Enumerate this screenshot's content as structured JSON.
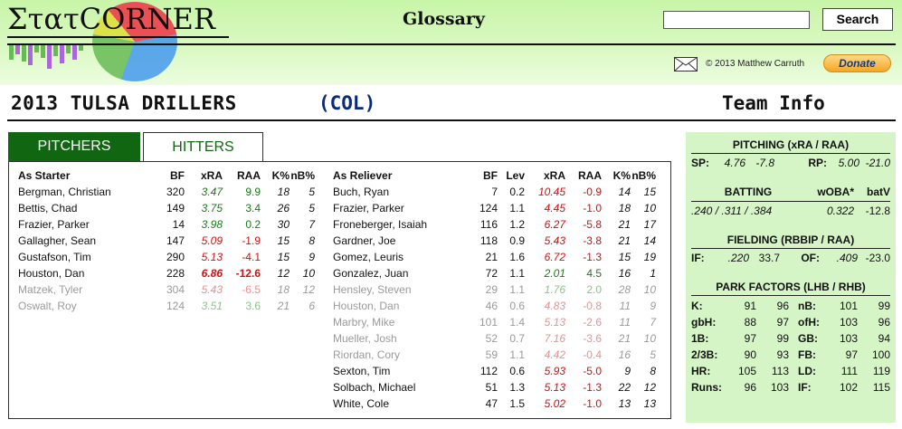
{
  "header": {
    "logo_text": "ΣτατCORNER",
    "glossary_label": "Glossary",
    "search_placeholder": "",
    "search_button": "Search",
    "copyright": "© 2013 Matthew Carruth",
    "donate_label": "Donate"
  },
  "team": {
    "title": "2013 TULSA DRILLERS",
    "abbr": "(COL)",
    "info_label": "Team Info"
  },
  "tabs": {
    "pitchers": "PITCHERS",
    "hitters": "HITTERS"
  },
  "starters": {
    "headers": [
      "As Starter",
      "BF",
      "xRA",
      "RAA",
      "K%",
      "nB%"
    ],
    "rows": [
      {
        "name": "Bergman, Christian",
        "bf": "320",
        "xra": "3.47",
        "raa": "9.9",
        "k": "18",
        "nb": "5",
        "xra_c": "green",
        "raa_c": "green",
        "dim": false
      },
      {
        "name": "Bettis, Chad",
        "bf": "149",
        "xra": "3.75",
        "raa": "3.4",
        "k": "26",
        "nb": "5",
        "xra_c": "green",
        "raa_c": "green",
        "dim": false
      },
      {
        "name": "Frazier, Parker",
        "bf": "14",
        "xra": "3.98",
        "raa": "0.2",
        "k": "30",
        "nb": "7",
        "xra_c": "green",
        "raa_c": "green",
        "dim": false
      },
      {
        "name": "Gallagher, Sean",
        "bf": "147",
        "xra": "5.09",
        "raa": "-1.9",
        "k": "15",
        "nb": "8",
        "xra_c": "red",
        "raa_c": "red",
        "dim": false
      },
      {
        "name": "Gustafson, Tim",
        "bf": "290",
        "xra": "5.13",
        "raa": "-4.1",
        "k": "15",
        "nb": "9",
        "xra_c": "red",
        "raa_c": "red",
        "dim": false
      },
      {
        "name": "Houston, Dan",
        "bf": "228",
        "xra": "6.86",
        "raa": "-12.6",
        "k": "12",
        "nb": "10",
        "xra_c": "red bold",
        "raa_c": "red bold",
        "dim": false
      },
      {
        "name": "Matzek, Tyler",
        "bf": "304",
        "xra": "5.43",
        "raa": "-6.5",
        "k": "18",
        "nb": "12",
        "xra_c": "red",
        "raa_c": "red",
        "dim": true
      },
      {
        "name": "Oswalt, Roy",
        "bf": "124",
        "xra": "3.51",
        "raa": "3.6",
        "k": "21",
        "nb": "6",
        "xra_c": "green",
        "raa_c": "green",
        "dim": true
      }
    ]
  },
  "relievers": {
    "headers": [
      "As Reliever",
      "BF",
      "Lev",
      "xRA",
      "RAA",
      "K%",
      "nB%"
    ],
    "rows": [
      {
        "name": "Buch, Ryan",
        "bf": "7",
        "lev": "0.2",
        "xra": "10.45",
        "raa": "-0.9",
        "k": "14",
        "nb": "15",
        "xra_c": "red",
        "raa_c": "red",
        "dim": false
      },
      {
        "name": "Frazier, Parker",
        "bf": "124",
        "lev": "1.1",
        "xra": "4.45",
        "raa": "-1.0",
        "k": "18",
        "nb": "10",
        "xra_c": "red",
        "raa_c": "red",
        "dim": false
      },
      {
        "name": "Froneberger, Isaiah",
        "bf": "116",
        "lev": "1.2",
        "xra": "6.27",
        "raa": "-5.8",
        "k": "21",
        "nb": "17",
        "xra_c": "red",
        "raa_c": "red",
        "dim": false
      },
      {
        "name": "Gardner, Joe",
        "bf": "118",
        "lev": "0.9",
        "xra": "5.43",
        "raa": "-3.8",
        "k": "21",
        "nb": "14",
        "xra_c": "red",
        "raa_c": "red",
        "dim": false
      },
      {
        "name": "Gomez, Leuris",
        "bf": "21",
        "lev": "1.6",
        "xra": "6.72",
        "raa": "-1.3",
        "k": "15",
        "nb": "19",
        "xra_c": "red",
        "raa_c": "red",
        "dim": false
      },
      {
        "name": "Gonzalez, Juan",
        "bf": "72",
        "lev": "1.1",
        "xra": "2.01",
        "raa": "4.5",
        "k": "16",
        "nb": "1",
        "xra_c": "green",
        "raa_c": "green",
        "dim": false
      },
      {
        "name": "Hensley, Steven",
        "bf": "29",
        "lev": "1.1",
        "xra": "1.76",
        "raa": "2.0",
        "k": "28",
        "nb": "10",
        "xra_c": "green",
        "raa_c": "green",
        "dim": true
      },
      {
        "name": "Houston, Dan",
        "bf": "46",
        "lev": "0.6",
        "xra": "4.83",
        "raa": "-0.8",
        "k": "11",
        "nb": "9",
        "xra_c": "red",
        "raa_c": "red",
        "dim": true
      },
      {
        "name": "Marbry, Mike",
        "bf": "101",
        "lev": "1.4",
        "xra": "5.13",
        "raa": "-2.6",
        "k": "11",
        "nb": "7",
        "xra_c": "red",
        "raa_c": "red",
        "dim": true
      },
      {
        "name": "Mueller, Josh",
        "bf": "52",
        "lev": "0.7",
        "xra": "7.16",
        "raa": "-3.6",
        "k": "21",
        "nb": "10",
        "xra_c": "red",
        "raa_c": "red",
        "dim": true
      },
      {
        "name": "Riordan, Cory",
        "bf": "59",
        "lev": "1.1",
        "xra": "4.42",
        "raa": "-0.4",
        "k": "16",
        "nb": "5",
        "xra_c": "red",
        "raa_c": "red",
        "dim": true
      },
      {
        "name": "Sexton, Tim",
        "bf": "112",
        "lev": "0.6",
        "xra": "5.93",
        "raa": "-5.0",
        "k": "9",
        "nb": "8",
        "xra_c": "red",
        "raa_c": "red",
        "dim": false
      },
      {
        "name": "Solbach, Michael",
        "bf": "51",
        "lev": "1.3",
        "xra": "5.13",
        "raa": "-1.3",
        "k": "22",
        "nb": "12",
        "xra_c": "red",
        "raa_c": "red",
        "dim": false
      },
      {
        "name": "White, Cole",
        "bf": "47",
        "lev": "1.5",
        "xra": "5.02",
        "raa": "-1.0",
        "k": "13",
        "nb": "13",
        "xra_c": "red",
        "raa_c": "red",
        "dim": false
      }
    ]
  },
  "side": {
    "pitching": {
      "title": "PITCHING (xRA / RAA)",
      "sp_label": "SP:",
      "sp_xra": "4.76",
      "sp_raa": "-7.8",
      "rp_label": "RP:",
      "rp_xra": "5.00",
      "rp_raa": "-21.0"
    },
    "batting": {
      "title": "BATTING",
      "woba_label": "wOBA*",
      "batv_label": "batV",
      "slash": ".240 / .311 / .384",
      "woba": "0.322",
      "batv": "-12.8"
    },
    "fielding": {
      "title": "FIELDING (RBBIP / RAA)",
      "if_label": "IF:",
      "if_rbbip": ".220",
      "if_raa": "33.7",
      "of_label": "OF:",
      "of_rbbip": ".409",
      "of_raa": "-23.0"
    },
    "park": {
      "title": "PARK FACTORS (LHB / RHB)",
      "rows": [
        {
          "l1": "K:",
          "a": "91",
          "b": "96",
          "l2": "nB:",
          "c": "101",
          "d": "99"
        },
        {
          "l1": "gbH:",
          "a": "88",
          "b": "97",
          "l2": "ofH:",
          "c": "103",
          "d": "96"
        },
        {
          "l1": "1B:",
          "a": "97",
          "b": "99",
          "l2": "GB:",
          "c": "103",
          "d": "94"
        },
        {
          "l1": "2/3B:",
          "a": "90",
          "b": "93",
          "l2": "FB:",
          "c": "97",
          "d": "100"
        },
        {
          "l1": "HR:",
          "a": "105",
          "b": "113",
          "l2": "LD:",
          "c": "111",
          "d": "119"
        },
        {
          "l1": "Runs:",
          "a": "96",
          "b": "103",
          "l2": "IF:",
          "c": "102",
          "d": "115"
        }
      ]
    }
  },
  "colors": {
    "green_text": "#1a7a1a",
    "red_text": "#d01010",
    "tab_green": "#116611",
    "side_bg": "#d6f5c6"
  },
  "icons": [
    "mail-icon",
    "baseball-logo-icon"
  ]
}
